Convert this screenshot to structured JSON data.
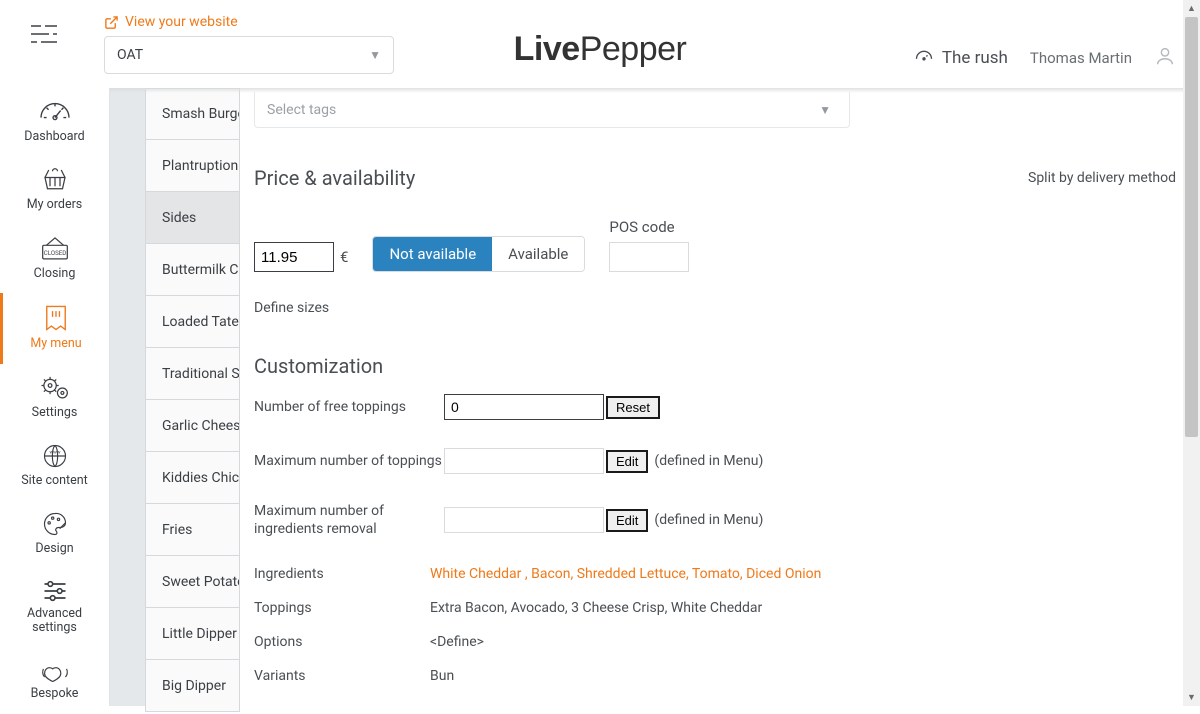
{
  "header": {
    "view_website": "View your website",
    "brand": "OAT",
    "logo_main": "LivePepper",
    "rush_label": "The rush",
    "user_name": "Thomas Martin"
  },
  "sidebar": {
    "items": [
      {
        "id": "dashboard",
        "label": "Dashboard"
      },
      {
        "id": "orders",
        "label": "My orders"
      },
      {
        "id": "closing",
        "label": "Closing"
      },
      {
        "id": "menu",
        "label": "My menu"
      },
      {
        "id": "settings",
        "label": "Settings"
      },
      {
        "id": "sitecontent",
        "label": "Site content"
      },
      {
        "id": "design",
        "label": "Design"
      },
      {
        "id": "advanced",
        "label": "Advanced settings"
      },
      {
        "id": "bespoke",
        "label": "Bespoke"
      }
    ],
    "active": "menu"
  },
  "categories": [
    "Smash Burger",
    "Plantruption",
    "Sides",
    "Buttermilk Ch",
    "Loaded Tater",
    "Traditional Sp",
    "Garlic Cheese",
    "Kiddies Chick",
    "Fries",
    "Sweet Potato",
    "Little Dipper",
    "Big Dipper"
  ],
  "tags": {
    "placeholder": "Select tags"
  },
  "price": {
    "section": "Price & availability",
    "split_link": "Split by delivery method",
    "value": "11.95",
    "currency": "€",
    "availability": {
      "not_available": "Not available",
      "available": "Available",
      "current": "not_available"
    },
    "pos_label": "POS code",
    "pos_value": "",
    "define_sizes": "Define sizes"
  },
  "customization": {
    "section": "Customization",
    "free_toppings": {
      "label": "Number of free toppings",
      "value": "0",
      "reset": "Reset"
    },
    "max_toppings": {
      "label": "Maximum number of toppings",
      "value": "",
      "edit": "Edit",
      "hint": "(defined in Menu)"
    },
    "max_removal": {
      "label": "Maximum number of ingredients removal",
      "value": "",
      "edit": "Edit",
      "hint": "(defined in Menu)"
    },
    "ingredients": {
      "label": "Ingredients",
      "value": "White Cheddar , Bacon, Shredded Lettuce, Tomato, Diced Onion"
    },
    "toppings": {
      "label": "Toppings",
      "value": "Extra Bacon, Avocado, 3 Cheese Crisp, White Cheddar"
    },
    "options": {
      "label": "Options",
      "value": "<Define>"
    },
    "variants": {
      "label": "Variants",
      "value": "Bun"
    }
  }
}
